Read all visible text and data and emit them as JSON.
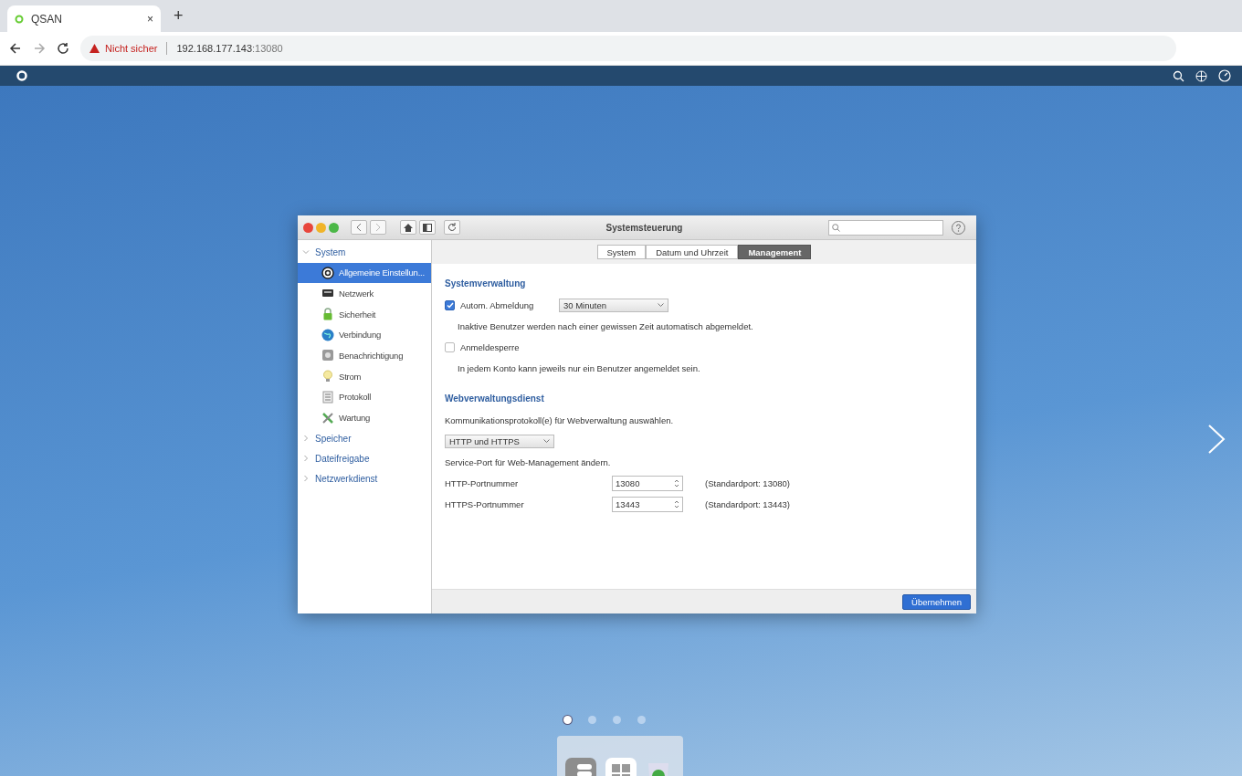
{
  "browser": {
    "tab": {
      "title": "QSAN",
      "close": "×"
    },
    "new_tab": "+",
    "address": {
      "warning": "Nicht sicher",
      "host": "192.168.177.143",
      "port": ":13080"
    }
  },
  "window": {
    "title": "Systemsteuerung",
    "tabs": [
      {
        "label": "System",
        "selected": false
      },
      {
        "label": "Datum und Uhrzeit",
        "selected": false
      },
      {
        "label": "Management",
        "selected": true
      }
    ],
    "sidebar": [
      {
        "label": "System",
        "expanded": true,
        "children": [
          {
            "label": "Allgemeine Einstellun...",
            "selected": true
          },
          {
            "label": "Netzwerk",
            "selected": false
          },
          {
            "label": "Sicherheit",
            "selected": false
          },
          {
            "label": "Verbindung",
            "selected": false
          },
          {
            "label": "Benachrichtigung",
            "selected": false
          },
          {
            "label": "Strom",
            "selected": false
          },
          {
            "label": "Protokoll",
            "selected": false
          },
          {
            "label": "Wartung",
            "selected": false
          }
        ]
      },
      {
        "label": "Speicher",
        "expanded": false
      },
      {
        "label": "Dateifreigabe",
        "expanded": false
      },
      {
        "label": "Netzwerkdienst",
        "expanded": false
      }
    ],
    "content": {
      "sections": [
        {
          "title": "Systemverwaltung",
          "items": [
            {
              "kind": "checkbox",
              "label": "Autom. Abmeldung",
              "checked": true,
              "select": "30 Minuten"
            },
            {
              "kind": "note",
              "text": "Inaktive Benutzer werden nach einer gewissen Zeit automatisch abgemeldet."
            },
            {
              "kind": "checkbox",
              "label": "Anmeldesperre",
              "checked": false
            },
            {
              "kind": "note",
              "text": "In jedem Konto kann jeweils nur ein Benutzer angemeldet sein."
            }
          ]
        },
        {
          "title": "Webverwaltungsdienst",
          "items": [
            {
              "kind": "text",
              "text": "Kommunikationsprotokoll(e) für Webverwaltung auswählen."
            },
            {
              "kind": "select",
              "value": "HTTP und HTTPS"
            },
            {
              "kind": "text",
              "text": "Service-Port für Web-Management ändern."
            },
            {
              "kind": "port",
              "label": "HTTP-Portnummer",
              "value": "13080",
              "hint": "(Standardport: 13080)"
            },
            {
              "kind": "port",
              "label": "HTTPS-Portnummer",
              "value": "13443",
              "hint": "(Standardport: 13443)"
            }
          ]
        }
      ]
    },
    "apply_button": "Übernehmen"
  },
  "pager": [
    {
      "selected": true
    },
    {
      "selected": false
    },
    {
      "selected": false
    },
    {
      "selected": false
    }
  ]
}
